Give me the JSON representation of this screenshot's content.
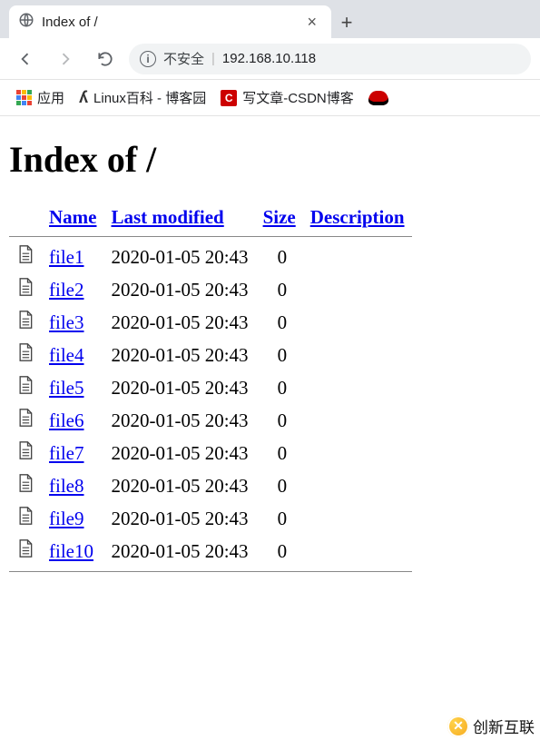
{
  "tab": {
    "title": "Index of /"
  },
  "address": {
    "insecure": "不安全",
    "url": "192.168.10.118"
  },
  "bookmarks": {
    "apps": "应用",
    "items": [
      {
        "label": "Linux百科 - 博客园"
      },
      {
        "label": "写文章-CSDN博客"
      }
    ]
  },
  "page": {
    "heading": "Index of /",
    "headers": {
      "name": "Name",
      "last_modified": "Last modified",
      "size": "Size",
      "description": "Description"
    },
    "rows": [
      {
        "name": "file1",
        "modified": "2020-01-05 20:43",
        "size": "0"
      },
      {
        "name": "file2",
        "modified": "2020-01-05 20:43",
        "size": "0"
      },
      {
        "name": "file3",
        "modified": "2020-01-05 20:43",
        "size": "0"
      },
      {
        "name": "file4",
        "modified": "2020-01-05 20:43",
        "size": "0"
      },
      {
        "name": "file5",
        "modified": "2020-01-05 20:43",
        "size": "0"
      },
      {
        "name": "file6",
        "modified": "2020-01-05 20:43",
        "size": "0"
      },
      {
        "name": "file7",
        "modified": "2020-01-05 20:43",
        "size": "0"
      },
      {
        "name": "file8",
        "modified": "2020-01-05 20:43",
        "size": "0"
      },
      {
        "name": "file9",
        "modified": "2020-01-05 20:43",
        "size": "0"
      },
      {
        "name": "file10",
        "modified": "2020-01-05 20:43",
        "size": "0"
      }
    ]
  },
  "watermark": {
    "text": "创新互联"
  }
}
